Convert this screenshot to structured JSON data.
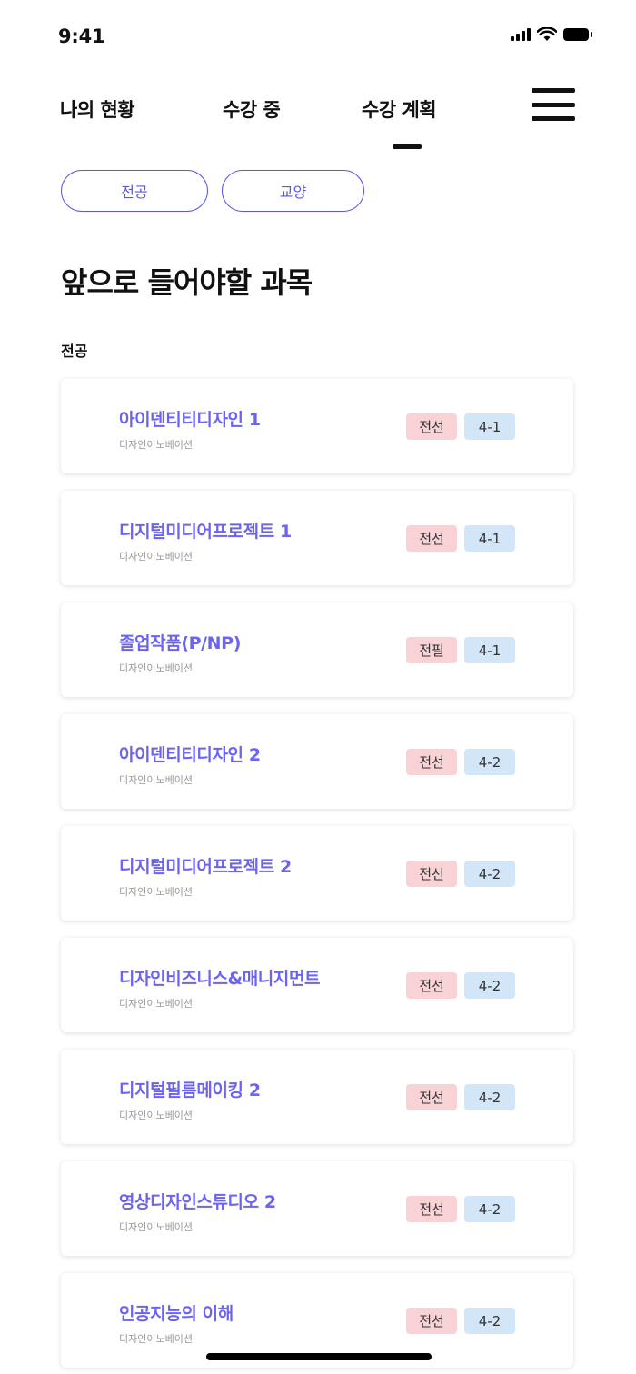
{
  "status_bar": {
    "time": "9:41"
  },
  "nav": {
    "tabs": [
      {
        "label": "나의 현황"
      },
      {
        "label": "수강 중"
      },
      {
        "label": "수강 계획"
      }
    ],
    "active_tab": "수강 계획"
  },
  "filters": [
    {
      "label": "전공"
    },
    {
      "label": "교양"
    }
  ],
  "page_title": "앞으로 들어야할 과목",
  "section_label": "전공",
  "courses": [
    {
      "name": "아이덴티티디자인 1",
      "department": "디자인이노베이션",
      "type": "전선",
      "term": "4-1"
    },
    {
      "name": "디지털미디어프로젝트 1",
      "department": "디자인이노베이션",
      "type": "전선",
      "term": "4-1"
    },
    {
      "name": "졸업작품(P/NP)",
      "department": "디자인이노베이션",
      "type": "전필",
      "term": "4-1"
    },
    {
      "name": "아이덴티티디자인 2",
      "department": "디자인이노베이션",
      "type": "전선",
      "term": "4-2"
    },
    {
      "name": "디지털미디어프로젝트 2",
      "department": "디자인이노베이션",
      "type": "전선",
      "term": "4-2"
    },
    {
      "name": "디자인비즈니스&매니지먼트",
      "department": "디자인이노베이션",
      "type": "전선",
      "term": "4-2"
    },
    {
      "name": "디지털필름메이킹 2",
      "department": "디자인이노베이션",
      "type": "전선",
      "term": "4-2"
    },
    {
      "name": "영상디자인스튜디오 2",
      "department": "디자인이노베이션",
      "type": "전선",
      "term": "4-2"
    },
    {
      "name": "인공지능의 이해",
      "department": "디자인이노베이션",
      "type": "전선",
      "term": "4-2"
    }
  ],
  "colors": {
    "accent": "#5b55e8",
    "course_title": "#6c63f0",
    "type_badge_bg": "#f8d2d5",
    "term_badge_bg": "#d3e6f7"
  }
}
